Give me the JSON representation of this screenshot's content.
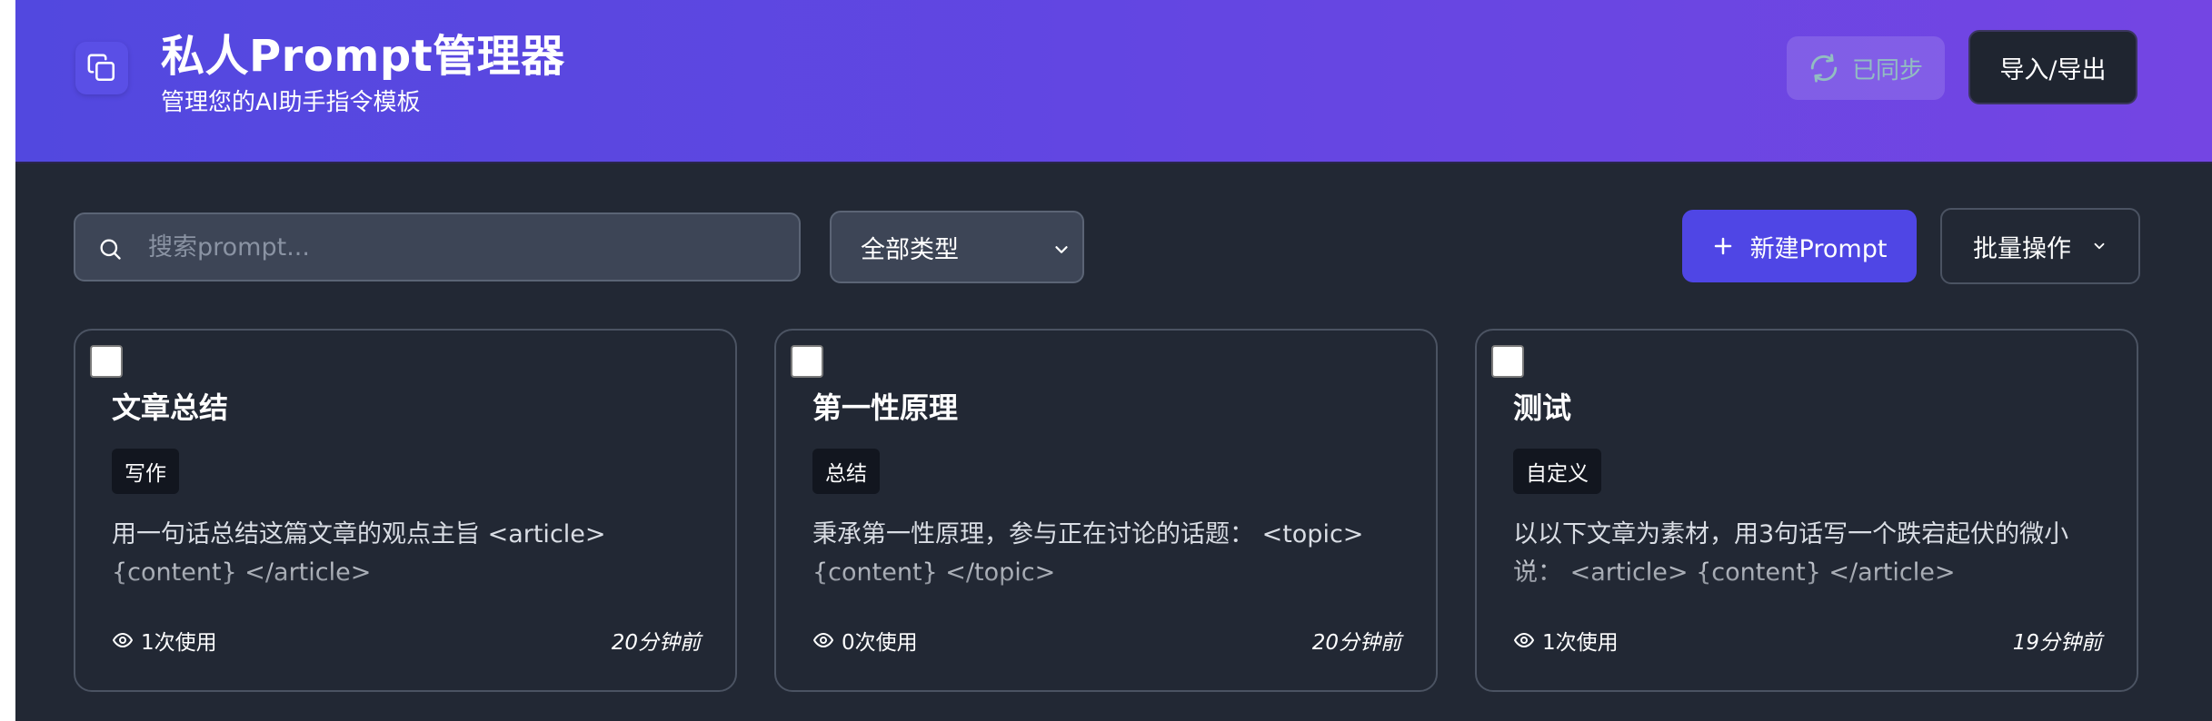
{
  "header": {
    "title": "私人Prompt管理器",
    "subtitle": "管理您的AI助手指令模板",
    "logo_icon": "copy-icon",
    "sync_label": "已同步",
    "sync_icon": "refresh-icon",
    "import_export_label": "导入/导出"
  },
  "toolbar": {
    "search_placeholder": "搜索prompt...",
    "type_filter_value": "全部类型",
    "new_prompt_label": "新建Prompt",
    "batch_label": "批量操作"
  },
  "colors": {
    "header_gradient_start": "#5248df",
    "header_gradient_end": "#7445e3",
    "background": "#222834",
    "primary_button": "#4f46e5",
    "sync_text": "#9ee6b6"
  },
  "cards": [
    {
      "title": "文章总结",
      "tag": "写作",
      "content": "用一句话总结这篇文章的观点主旨 <article> {content} </article>",
      "usage": "1次使用",
      "time": "20分钟前"
    },
    {
      "title": "第一性原理",
      "tag": "总结",
      "content": "秉承第一性原理，参与正在讨论的话题： <topic> {content} </topic>",
      "usage": "0次使用",
      "time": "20分钟前"
    },
    {
      "title": "测试",
      "tag": "自定义",
      "content": "以以下文章为素材，用3句话写一个跌宕起伏的微小说： <article> {content} </article>",
      "usage": "1次使用",
      "time": "19分钟前"
    }
  ]
}
